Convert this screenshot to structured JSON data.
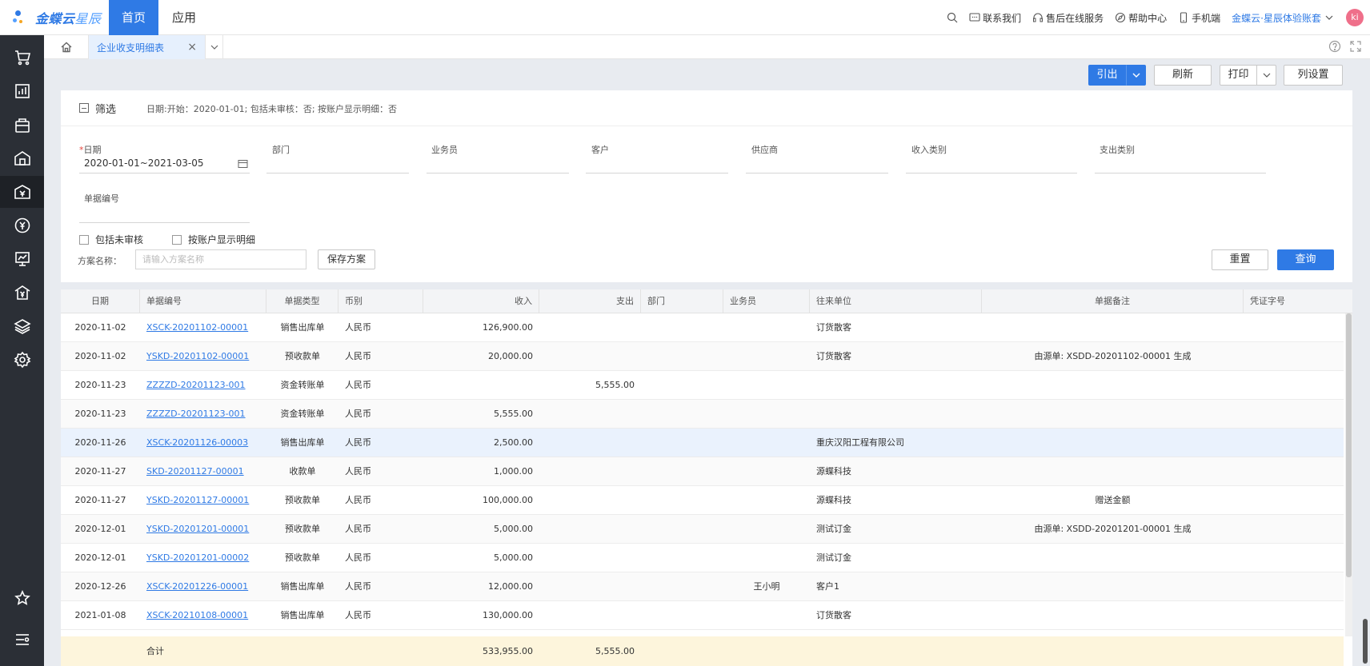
{
  "brand": {
    "name": "金蝶云",
    "sub": "星辰",
    "colors": {
      "primary": "#2f7ae5",
      "sidebar": "#2b2f36",
      "avatar": "#ef6f8a"
    }
  },
  "topnav": {
    "tabs": [
      "首页",
      "应用"
    ],
    "links": [
      "联系我们",
      "售后在线服务",
      "帮助中心",
      "手机端"
    ],
    "account": "金蝶云·星辰体验账套",
    "avatar": "ki"
  },
  "sidebar": {
    "icons": [
      "cart-icon",
      "report-icon",
      "bag-icon",
      "warehouse-icon",
      "finance-icon",
      "yuan-icon",
      "monitor-icon",
      "house-yuan-icon",
      "layers-icon",
      "settings-icon",
      "star-icon",
      "menu-icon"
    ]
  },
  "tabbar": {
    "active_tab": "企业收支明细表",
    "close": "×"
  },
  "toolbar": {
    "export": "引出",
    "refresh": "刷新",
    "print": "打印",
    "columns": "列设置"
  },
  "filter": {
    "title": "筛选",
    "summary": "日期:开始：2020-01-01; 包括未审核：否; 按账户显示明细：否",
    "fields": {
      "date": {
        "label": "日期",
        "value": "2020-01-01~2021-03-05"
      },
      "department": {
        "label": "部门"
      },
      "salesman": {
        "label": "业务员"
      },
      "customer": {
        "label": "客户"
      },
      "supplier": {
        "label": "供应商"
      },
      "income_type": {
        "label": "收入类别"
      },
      "expense_type": {
        "label": "支出类别"
      },
      "doc_no": {
        "label": "单据编号"
      }
    },
    "include_unaudited": "包括未审核",
    "show_by_account": "按账户显示明细",
    "scheme_label": "方案名称：",
    "scheme_placeholder": "请输入方案名称",
    "save_scheme": "保存方案",
    "reset": "重置",
    "query": "查询"
  },
  "table": {
    "columns": [
      "日期",
      "单据编号",
      "单据类型",
      "币别",
      "收入",
      "支出",
      "部门",
      "业务员",
      "往来单位",
      "单据备注",
      "凭证字号"
    ],
    "rows": [
      {
        "date": "2020-11-02",
        "no": "XSCK-20201102-00001",
        "type": "销售出库单",
        "currency": "人民币",
        "income": "126,900.00",
        "expense": "",
        "dept": "",
        "salesman": "",
        "partner": "订货散客",
        "remark": "",
        "voucher": ""
      },
      {
        "date": "2020-11-02",
        "no": "YSKD-20201102-00001",
        "type": "预收款单",
        "currency": "人民币",
        "income": "20,000.00",
        "expense": "",
        "dept": "",
        "salesman": "",
        "partner": "订货散客",
        "remark": "由源单: XSDD-20201102-00001 生成",
        "voucher": ""
      },
      {
        "date": "2020-11-23",
        "no": "ZZZZD-20201123-001",
        "type": "资金转账单",
        "currency": "人民币",
        "income": "",
        "expense": "5,555.00",
        "dept": "",
        "salesman": "",
        "partner": "",
        "remark": "",
        "voucher": ""
      },
      {
        "date": "2020-11-23",
        "no": "ZZZZD-20201123-001",
        "type": "资金转账单",
        "currency": "人民币",
        "income": "5,555.00",
        "expense": "",
        "dept": "",
        "salesman": "",
        "partner": "",
        "remark": "",
        "voucher": ""
      },
      {
        "date": "2020-11-26",
        "no": "XSCK-20201126-00003",
        "type": "销售出库单",
        "currency": "人民币",
        "income": "2,500.00",
        "expense": "",
        "dept": "",
        "salesman": "",
        "partner": "重庆汉阳工程有限公司",
        "remark": "",
        "voucher": ""
      },
      {
        "date": "2020-11-27",
        "no": "SKD-20201127-00001",
        "type": "收款单",
        "currency": "人民币",
        "income": "1,000.00",
        "expense": "",
        "dept": "",
        "salesman": "",
        "partner": "源蝶科技",
        "remark": "",
        "voucher": ""
      },
      {
        "date": "2020-11-27",
        "no": "YSKD-20201127-00001",
        "type": "预收款单",
        "currency": "人民币",
        "income": "100,000.00",
        "expense": "",
        "dept": "",
        "salesman": "",
        "partner": "源蝶科技",
        "remark": "赠送金额",
        "voucher": ""
      },
      {
        "date": "2020-12-01",
        "no": "YSKD-20201201-00001",
        "type": "预收款单",
        "currency": "人民币",
        "income": "5,000.00",
        "expense": "",
        "dept": "",
        "salesman": "",
        "partner": "测试订金",
        "remark": "由源单: XSDD-20201201-00001 生成",
        "voucher": ""
      },
      {
        "date": "2020-12-01",
        "no": "YSKD-20201201-00002",
        "type": "预收款单",
        "currency": "人民币",
        "income": "5,000.00",
        "expense": "",
        "dept": "",
        "salesman": "",
        "partner": "测试订金",
        "remark": "",
        "voucher": ""
      },
      {
        "date": "2020-12-26",
        "no": "XSCK-20201226-00001",
        "type": "销售出库单",
        "currency": "人民币",
        "income": "12,000.00",
        "expense": "",
        "dept": "",
        "salesman": "王小明",
        "partner": "客户1",
        "remark": "",
        "voucher": ""
      },
      {
        "date": "2021-01-08",
        "no": "XSCK-20210108-00001",
        "type": "销售出库单",
        "currency": "人民币",
        "income": "130,000.00",
        "expense": "",
        "dept": "",
        "salesman": "",
        "partner": "订货散客",
        "remark": "",
        "voucher": ""
      }
    ],
    "total": {
      "label": "合计",
      "income": "533,955.00",
      "expense": "5,555.00"
    }
  }
}
